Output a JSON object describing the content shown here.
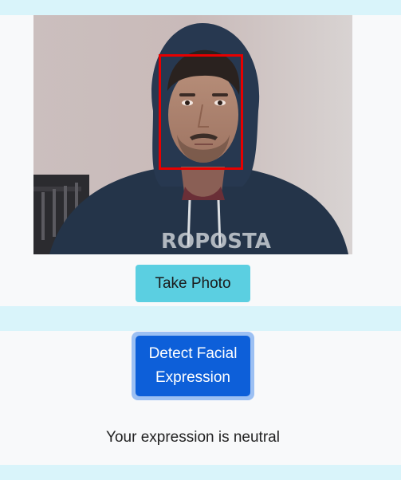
{
  "camera": {
    "alt": "Webcam capture with detected face",
    "face_box_color": "#e60000"
  },
  "buttons": {
    "take_photo": "Take Photo",
    "detect_expression": "Detect Facial Expression"
  },
  "result": {
    "text": "Your expression is neutral"
  },
  "colors": {
    "band": "#d9f4fa",
    "background": "#f8f9fa",
    "take_photo_bg": "#5bcfe1",
    "detect_bg": "#0d5fd9",
    "detect_focus_ring": "#9cc0f3"
  }
}
